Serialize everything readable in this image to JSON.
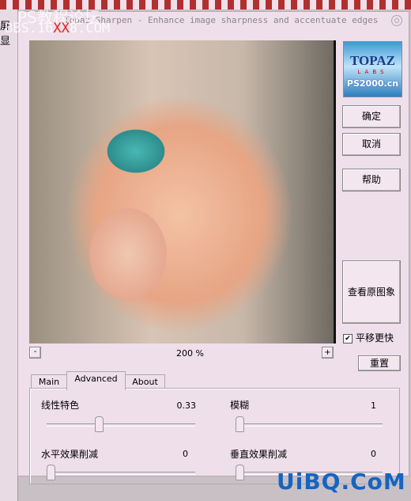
{
  "background": {
    "text": "屏显"
  },
  "watermarks": {
    "top": "PS教程论坛",
    "bbs_pre": "BBS.16",
    "bbs_red": "XX",
    "bbs_post": "8.COM",
    "bottom": "UiBQ.CoM"
  },
  "window": {
    "title": "Topaz Sharpen - Enhance image sharpness and accentuate edges"
  },
  "logo": {
    "brand": "TOPAZ",
    "sub": "LABS",
    "site": "PS2000.cn"
  },
  "buttons": {
    "ok": "确定",
    "cancel": "取消",
    "help": "帮助",
    "view_original": "查看原图象",
    "reset": "重置",
    "zoom_out": "-",
    "zoom_in": "+"
  },
  "pan_faster": {
    "label": "平移更快",
    "checked": true
  },
  "zoom_level": "200 %",
  "tabs": [
    {
      "label": "Main"
    },
    {
      "label": "Advanced",
      "active": true
    },
    {
      "label": "About"
    }
  ],
  "sliders": [
    {
      "label": "线性特色",
      "value": "0.33",
      "fraction": 0.34
    },
    {
      "label": "模糊",
      "value": "1",
      "fraction": 0.0
    },
    {
      "label": "水平效果削减",
      "value": "0",
      "fraction": 0.0
    },
    {
      "label": "垂直效果削减",
      "value": "0",
      "fraction": 0.0
    }
  ]
}
